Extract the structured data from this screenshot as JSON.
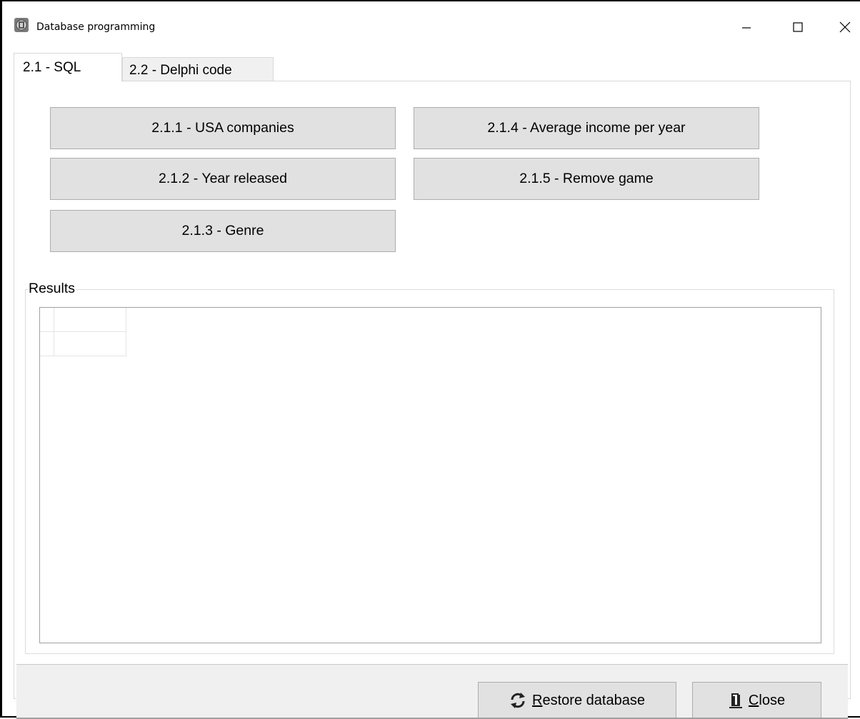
{
  "window": {
    "title": "Database programming",
    "icon": "database-app-icon",
    "controls": [
      "minimize-icon",
      "maximize-icon",
      "close-icon"
    ]
  },
  "tabs": [
    {
      "label": "2.1 - SQL",
      "active": true
    },
    {
      "label": "2.2 - Delphi code",
      "active": false
    }
  ],
  "sql_buttons": {
    "b211": "2.1.1 - USA companies",
    "b212": "2.1.2 - Year released",
    "b213": "2.1.3 - Genre",
    "b214": "2.1.4 - Average income per year",
    "b215": "2.1.5 - Remove game"
  },
  "results": {
    "group_label": "Results",
    "grid_rows": [
      [
        "",
        ""
      ],
      [
        "",
        ""
      ]
    ]
  },
  "footer": {
    "restore": {
      "accel": "R",
      "rest": "estore database",
      "icon": "refresh-icon"
    },
    "close": {
      "accel": "C",
      "rest": "lose",
      "icon": "exit-door-icon"
    }
  }
}
